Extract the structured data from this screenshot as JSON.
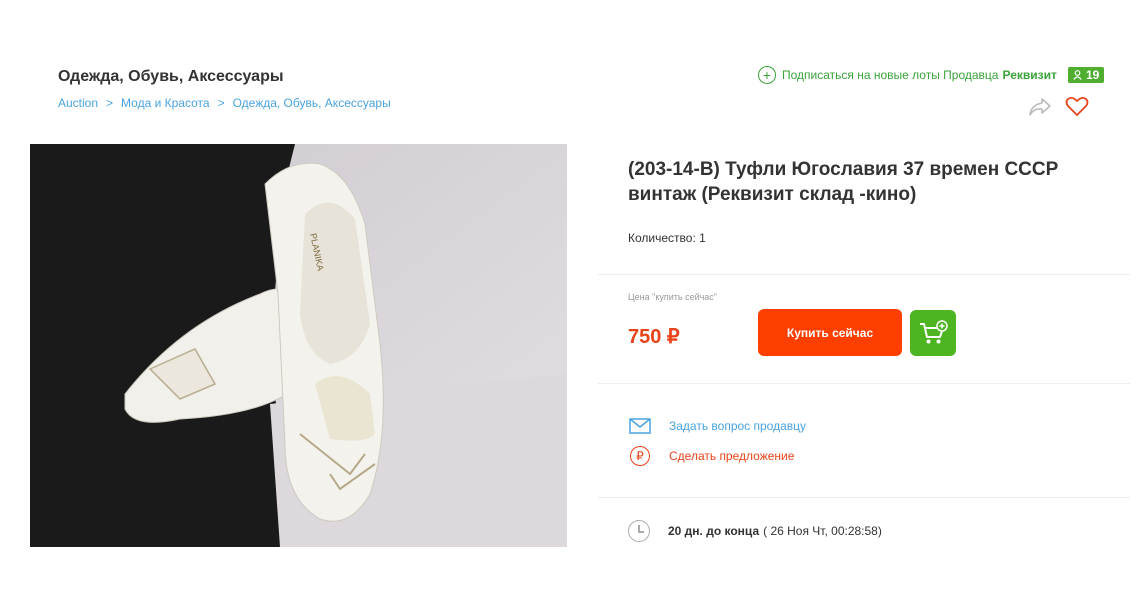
{
  "header": {
    "category_title": "Одежда, Обувь, Аксессуары",
    "breadcrumbs": [
      "Auction",
      "Мода и Красота",
      "Одежда, Обувь, Аксессуары"
    ],
    "breadcrumb_separator": ">"
  },
  "seller": {
    "subscribe_text": "Подписаться на новые лоты Продавца",
    "name": "Реквизит",
    "rating": "19"
  },
  "photo": {
    "box_lettering": "PLANIKA"
  },
  "lot": {
    "title": "(203-14-B) Туфли Югославия 37 времен СССР винтаж (Реквизит склад -кино)",
    "quantity_label": "Количество: 1"
  },
  "pricing": {
    "price_label": "Цена \"купить сейчас\"",
    "price": "750 ₽",
    "buy_button": "Купить сейчас"
  },
  "actions": {
    "ask_seller": "Задать вопрос продавцу",
    "make_offer": "Сделать предложение",
    "offer_icon_glyph": "₽"
  },
  "timer": {
    "remaining": "20 дн. до конца",
    "end_date": "( 26 Ноя Чт, 00:28:58)"
  },
  "colors": {
    "accent_blue": "#4aa3df",
    "buy_orange": "#fe3f00",
    "price_red": "#e8431a",
    "cart_green": "#4cb51f",
    "subscribe_green": "#3aa33a"
  },
  "icons": [
    "plus-circle-icon",
    "user-icon",
    "share-icon",
    "heart-icon",
    "cart-plus-icon",
    "envelope-icon",
    "ruble-circle-icon",
    "clock-icon"
  ]
}
